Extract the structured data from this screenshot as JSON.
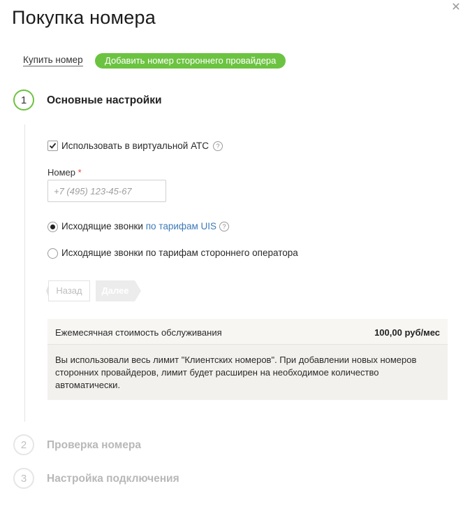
{
  "dialog": {
    "title": "Покупка номера",
    "close_icon": "close-icon"
  },
  "tabs": {
    "buy": "Купить номер",
    "add_third_party": "Добавить номер стороннего провайдера",
    "accent_color": "#6cc341"
  },
  "steps": [
    {
      "number": "1",
      "title": "Основные настройки",
      "state": "active"
    },
    {
      "number": "2",
      "title": "Проверка номера",
      "state": "inactive"
    },
    {
      "number": "3",
      "title": "Настройка подключения",
      "state": "inactive"
    }
  ],
  "form": {
    "use_in_pbx": {
      "label": "Использовать в виртуальной АТС",
      "checked": true,
      "help_icon": "question-icon"
    },
    "number_field": {
      "label": "Номер",
      "required_mark": "*",
      "placeholder": "+7 (495) 123-45-67",
      "value": ""
    },
    "calls_option_uis": {
      "label_prefix": "Исходящие звонки",
      "link_text": "по тарифам UIS",
      "selected": true
    },
    "calls_option_third": {
      "label": "Исходящие звонки по тарифам стороннего оператора",
      "selected": false
    }
  },
  "buttons": {
    "back": "Назад",
    "next": "Далее"
  },
  "cost": {
    "label": "Ежемесячная стоимость обслуживания",
    "value": "100,00 руб/мес",
    "notice": "Вы использовали весь лимит \"Клиентских номеров\". При добавлении новых номеров сторонних провайдеров, лимит будет расширен на необходимое количество автоматически."
  }
}
